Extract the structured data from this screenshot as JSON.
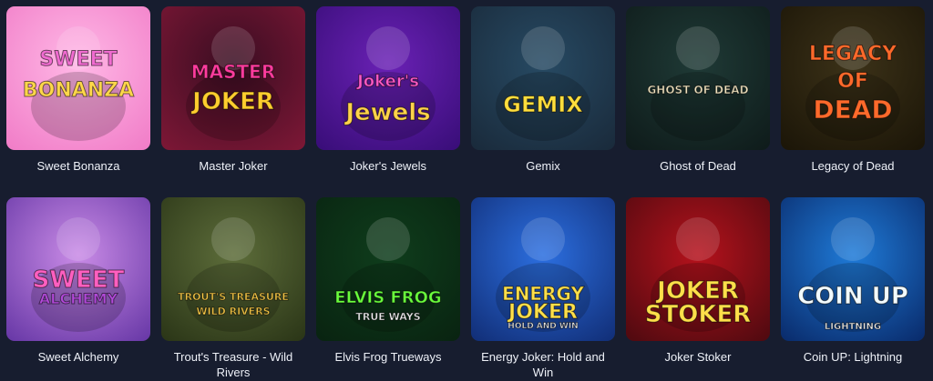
{
  "games": [
    {
      "label": "Sweet Bonanza",
      "art": [
        "SWEET",
        "BONANZA"
      ],
      "art_colors": [
        "#f06bd0",
        "#ffd74a"
      ],
      "bg": [
        "#ffb8e6",
        "#f17ec8"
      ]
    },
    {
      "label": "Master Joker",
      "art": [
        "MASTER",
        "JOKER"
      ],
      "art_colors": [
        "#ff3c9e",
        "#ffcd2e"
      ],
      "bg": [
        "#3a0d22",
        "#7b1735"
      ]
    },
    {
      "label": "Joker's Jewels",
      "art": [
        "Joker's",
        "Jewels"
      ],
      "art_colors": [
        "#ff59c9",
        "#ffd34a"
      ],
      "bg": [
        "#6a21b5",
        "#3a0e7a"
      ]
    },
    {
      "label": "Gemix",
      "art": [
        "GEMIX"
      ],
      "art_colors": [
        "#ffde3d"
      ],
      "bg": [
        "#274a63",
        "#1a2b3c"
      ]
    },
    {
      "label": "Ghost of Dead",
      "art": [
        "GHOST OF DEAD"
      ],
      "art_colors": [
        "#f2e6c2"
      ],
      "bg": [
        "#1f3a36",
        "#0f1c1b"
      ]
    },
    {
      "label": "Legacy of Dead",
      "art": [
        "LEGACY",
        "OF",
        "DEAD"
      ],
      "art_colors": [
        "#ff6a2b",
        "#ff6a2b",
        "#ff6a2b"
      ],
      "bg": [
        "#3c3218",
        "#1c1608"
      ]
    },
    {
      "label": "Sweet Alchemy",
      "art": [
        "SWEET",
        "ALCHEMY"
      ],
      "art_colors": [
        "#ff5fc0",
        "#b24ad9"
      ],
      "bg": [
        "#c98be6",
        "#6a3aa8"
      ]
    },
    {
      "label": "Trout's Treasure - Wild Rivers",
      "art": [
        "TROUT'S TREASURE",
        "WILD RIVERS"
      ],
      "art_colors": [
        "#ffd04a",
        "#ffd04a"
      ],
      "bg": [
        "#5d6d3a",
        "#2c3718"
      ]
    },
    {
      "label": "Elvis Frog Trueways",
      "art": [
        "ELVIS FROG",
        "TRUE WAYS"
      ],
      "art_colors": [
        "#6aff3d",
        "#ffffff"
      ],
      "bg": [
        "#0f3d1c",
        "#092411"
      ]
    },
    {
      "label": "Energy Joker: Hold and Win",
      "art": [
        "ENERGY",
        "JOKER",
        "HOLD AND WIN"
      ],
      "art_colors": [
        "#ffe04a",
        "#ffe04a",
        "#ffffff"
      ],
      "bg": [
        "#2c6fe0",
        "#12307a"
      ]
    },
    {
      "label": "Joker Stoker",
      "art": [
        "JOKER",
        "STOKER"
      ],
      "art_colors": [
        "#ffdf4a",
        "#ffdf4a"
      ],
      "bg": [
        "#b5121c",
        "#520a10"
      ]
    },
    {
      "label": "Coin UP: Lightning",
      "art": [
        "COIN UP",
        "LIGHTNING"
      ],
      "art_colors": [
        "#f2fbff",
        "#ffffff"
      ],
      "bg": [
        "#1f7bd8",
        "#0a2d6e"
      ]
    }
  ]
}
